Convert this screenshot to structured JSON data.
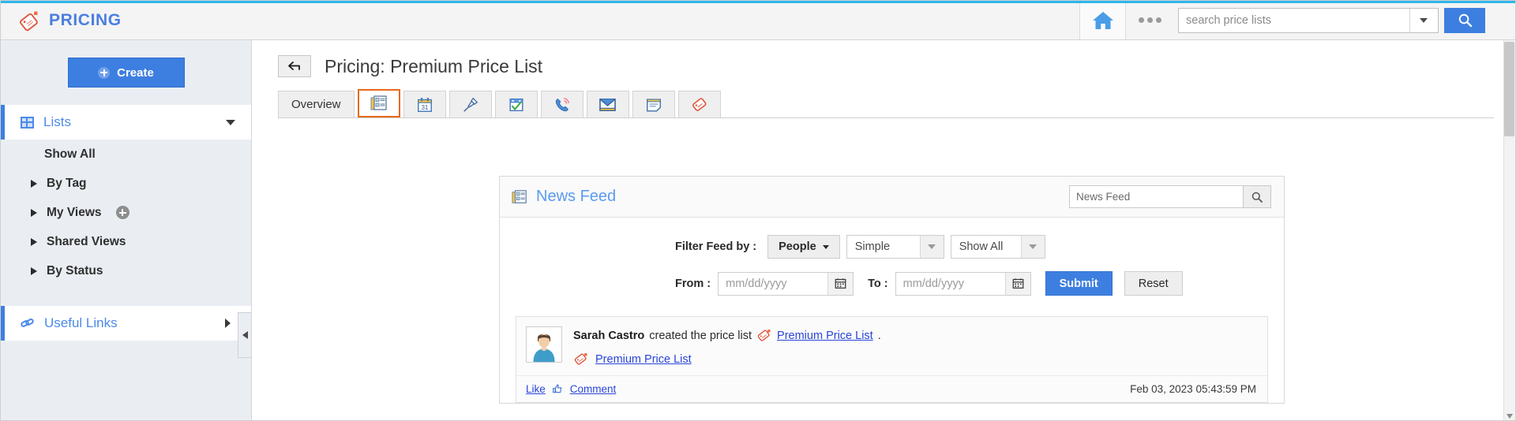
{
  "header": {
    "brand": "PRICING",
    "brand_color": "#4b7fe0",
    "accent_color": "#2fb6e9",
    "home_icon": "home-icon",
    "more_icon": "more-dots-icon",
    "search": {
      "placeholder": "search price lists",
      "value": "",
      "dropdown_icon": "chevron-down-icon",
      "button_icon": "search-icon"
    }
  },
  "sidebar": {
    "create_label": "Create",
    "create_icon": "plus-circle-icon",
    "nav": {
      "lists_label": "Lists",
      "lists_icon": "grid-icon",
      "lists_chevron": "chevron-down-icon",
      "useful_links_label": "Useful Links",
      "useful_links_icon": "link-icon",
      "useful_links_chevron": "chevron-right-icon"
    },
    "items": [
      {
        "label": "Show All",
        "chevron": false,
        "add": false
      },
      {
        "label": "By Tag",
        "chevron": true,
        "add": false
      },
      {
        "label": "My Views",
        "chevron": true,
        "add": true
      },
      {
        "label": "Shared Views",
        "chevron": true,
        "add": false
      },
      {
        "label": "By Status",
        "chevron": true,
        "add": false
      }
    ],
    "collapse_icon": "chevron-left-icon"
  },
  "main": {
    "back_icon": "back-arrow-icon",
    "page_title": "Pricing: Premium Price List",
    "tabs": [
      {
        "label": "Overview",
        "icon": "",
        "active": false
      },
      {
        "label": "",
        "icon": "news-feed-icon",
        "active": true
      },
      {
        "label": "",
        "icon": "calendar-icon",
        "active": false
      },
      {
        "label": "",
        "icon": "pin-icon",
        "active": false
      },
      {
        "label": "",
        "icon": "task-icon",
        "active": false
      },
      {
        "label": "",
        "icon": "phone-call-icon",
        "active": false
      },
      {
        "label": "",
        "icon": "email-icon",
        "active": false
      },
      {
        "label": "",
        "icon": "note-icon",
        "active": false
      },
      {
        "label": "",
        "icon": "attachment-icon",
        "active": false
      }
    ],
    "active_tab_color": "#e8691a"
  },
  "feed": {
    "title": "News Feed",
    "title_icon": "news-feed-icon",
    "search": {
      "placeholder": "News Feed",
      "value": "",
      "button_icon": "search-icon"
    },
    "filter": {
      "label": "Filter Feed by :",
      "people_button": "People",
      "people_caret": "caret-down-icon",
      "type_select": "Simple",
      "scope_select": "Show All",
      "select_arrow": "arrow-down-icon"
    },
    "dates": {
      "from_label": "From :",
      "from_placeholder": "mm/dd/yyyy",
      "from_value": "",
      "to_label": "To :",
      "to_placeholder": "mm/dd/yyyy",
      "to_value": "",
      "calendar_icon": "calendar-icon",
      "submit_label": "Submit",
      "reset_label": "Reset"
    },
    "item": {
      "avatar_icon": "user-avatar",
      "author": "Sarah Castro",
      "action_text": "created the price list",
      "tag_icon": "price-tag-icon",
      "link_text": "Premium Price List",
      "trailing_period": ".",
      "secondary_link_text": "Premium Price List",
      "like_label": "Like",
      "like_icon": "thumbs-up-icon",
      "comment_label": "Comment",
      "timestamp": "Feb 03, 2023 05:43:59 PM"
    }
  }
}
